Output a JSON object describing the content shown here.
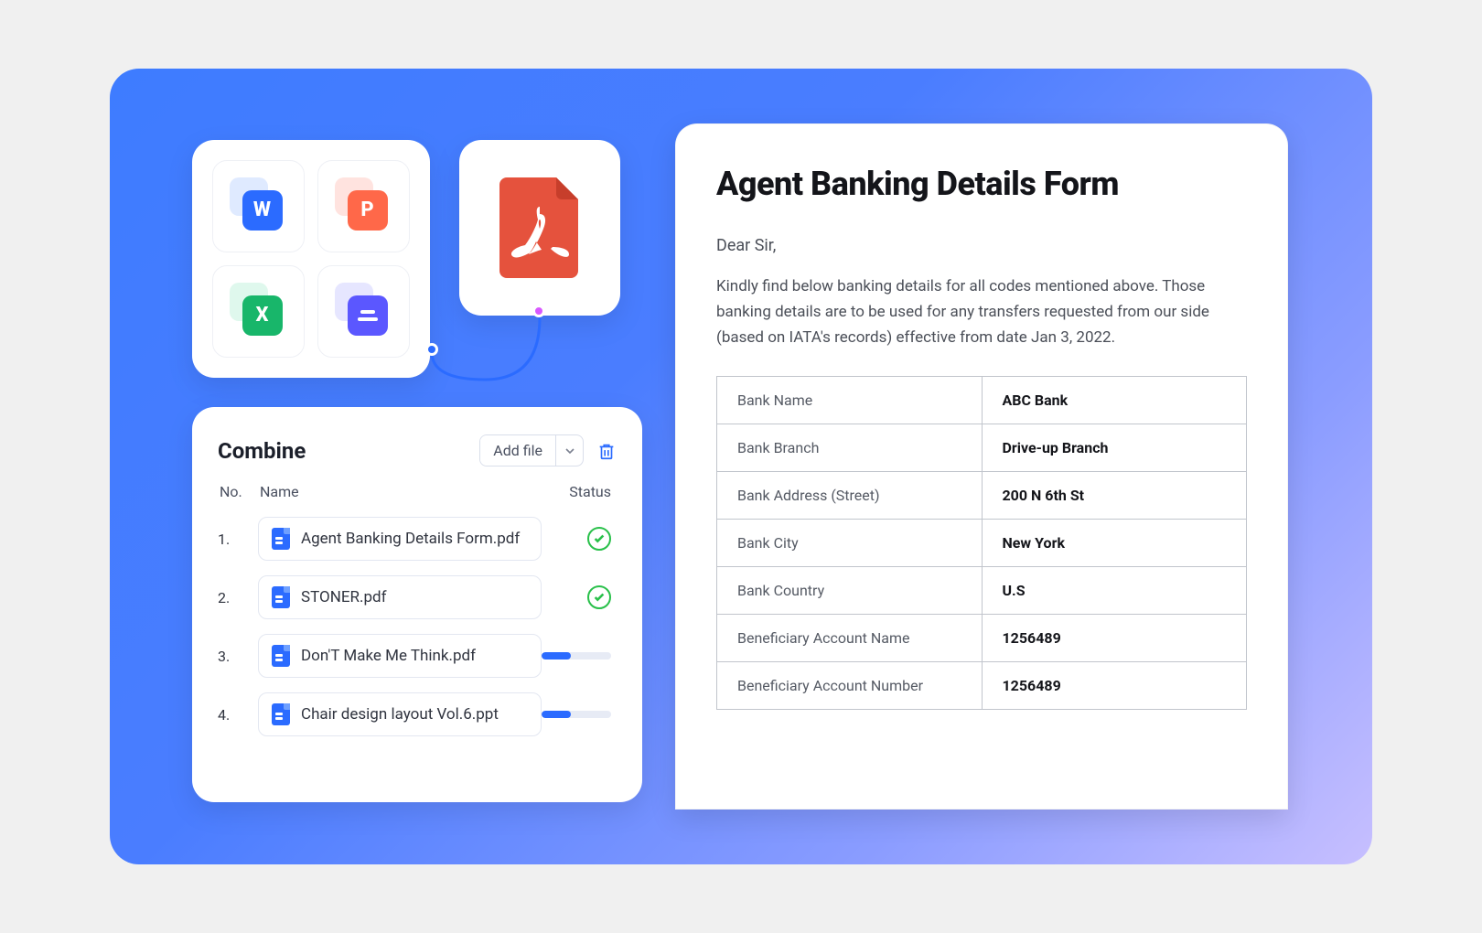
{
  "filetypes": {
    "word": "W",
    "ppt": "P",
    "excel": "X",
    "other": "="
  },
  "combine": {
    "title": "Combine",
    "add_file": "Add file",
    "cols": {
      "no": "No.",
      "name": "Name",
      "status": "Status"
    },
    "rows": [
      {
        "no": "1.",
        "name": "Agent Banking Details Form.pdf",
        "status": "done"
      },
      {
        "no": "2.",
        "name": "STONER.pdf",
        "status": "done"
      },
      {
        "no": "3.",
        "name": "Don'T Make Me Think.pdf",
        "status": "progress",
        "progress": 42
      },
      {
        "no": "4.",
        "name": "Chair design layout Vol.6.ppt",
        "status": "progress",
        "progress": 42
      }
    ]
  },
  "doc": {
    "title": "Agent Banking Details Form",
    "salutation": "Dear Sir,",
    "body": "Kindly find below banking details for all codes mentioned above. Those banking details are to be used for any transfers requested from our side (based on IATA's records) effective from date Jan 3, 2022.",
    "fields": [
      {
        "label": "Bank Name",
        "value": "ABC Bank"
      },
      {
        "label": "Bank Branch",
        "value": "Drive-up Branch"
      },
      {
        "label": "Bank Address (Street)",
        "value": "200 N 6th St"
      },
      {
        "label": "Bank City",
        "value": "New York"
      },
      {
        "label": "Bank Country",
        "value": "U.S"
      },
      {
        "label": "Beneficiary Account Name",
        "value": "1256489"
      },
      {
        "label": "Beneficiary Account Number",
        "value": "1256489"
      }
    ]
  }
}
